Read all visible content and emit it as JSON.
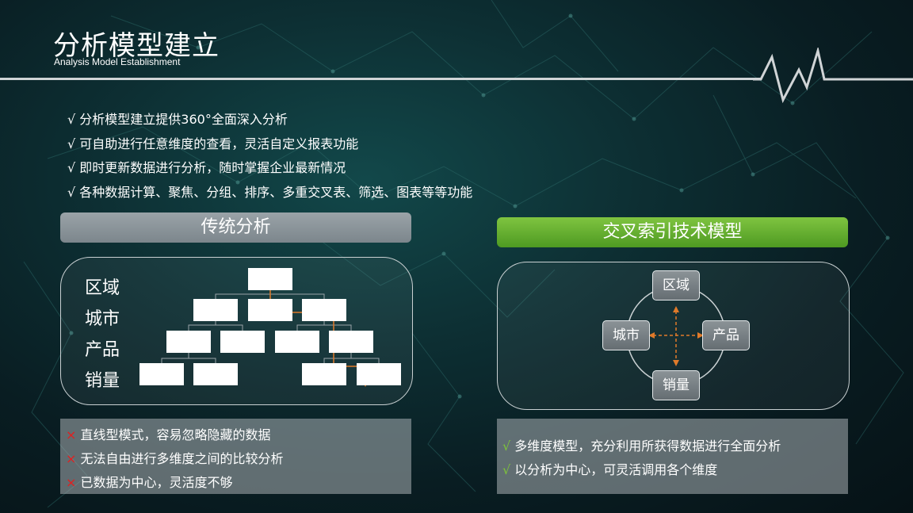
{
  "header": {
    "title": "分析模型建立",
    "subtitle": "Analysis Model Establishment"
  },
  "bullets": [
    "√ 分析模型建立提供360°全面深入分析",
    "√ 可自助进行任意维度的查看，灵活自定义报表功能",
    "√ 即时更新数据进行分析，随时掌握企业最新情况",
    "√ 各种数据计算、聚焦、分组、排序、多重交叉表、筛选、图表等等功能"
  ],
  "left_panel": {
    "header": "传统分析",
    "row_labels": [
      "区域",
      "城市",
      "产品",
      "销量"
    ],
    "cons_mark": "×",
    "cons": [
      "直线型模式，容易忽略隐藏的数据",
      "无法自由进行多维度之间的比较分析",
      "已数据为中心，灵活度不够"
    ]
  },
  "right_panel": {
    "header": "交叉索引技术模型",
    "nodes": {
      "top": "区域",
      "left": "城市",
      "right": "产品",
      "bottom": "销量"
    },
    "pros_mark": "√",
    "pros": [
      "多维度模型，充分利用所获得数据进行全面分析",
      "以分析为中心，可灵活调用各个维度"
    ]
  },
  "colors": {
    "background": "#0d2f33",
    "green_header": "#6fb535",
    "gray_header": "#8a9398",
    "arrow_orange": "#e07a2a",
    "cross_red": "#e02020",
    "check_green": "#7dc43a"
  }
}
